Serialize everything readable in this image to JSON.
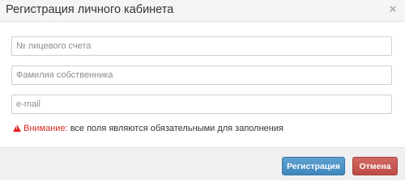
{
  "dialog": {
    "title": "Регистрация личного кабинета",
    "close_icon": "close-icon",
    "close_glyph": "×"
  },
  "form": {
    "account_number": {
      "value": "",
      "placeholder": "№ лицевого счета"
    },
    "owner_surname": {
      "value": "",
      "placeholder": "Фамилия собственника"
    },
    "email": {
      "value": "",
      "placeholder": "e-mail"
    }
  },
  "warning": {
    "icon": "warning-triangle-icon",
    "label": "Внимание:",
    "text": " все поля являются обязательными для заполнения"
  },
  "footer": {
    "register_label": "Регистрация",
    "cancel_label": "Отмена"
  },
  "colors": {
    "header_bg": "#f5f5f5",
    "primary": "#4a90c6",
    "danger": "#c9564f",
    "warning_red": "#d62a1e"
  }
}
